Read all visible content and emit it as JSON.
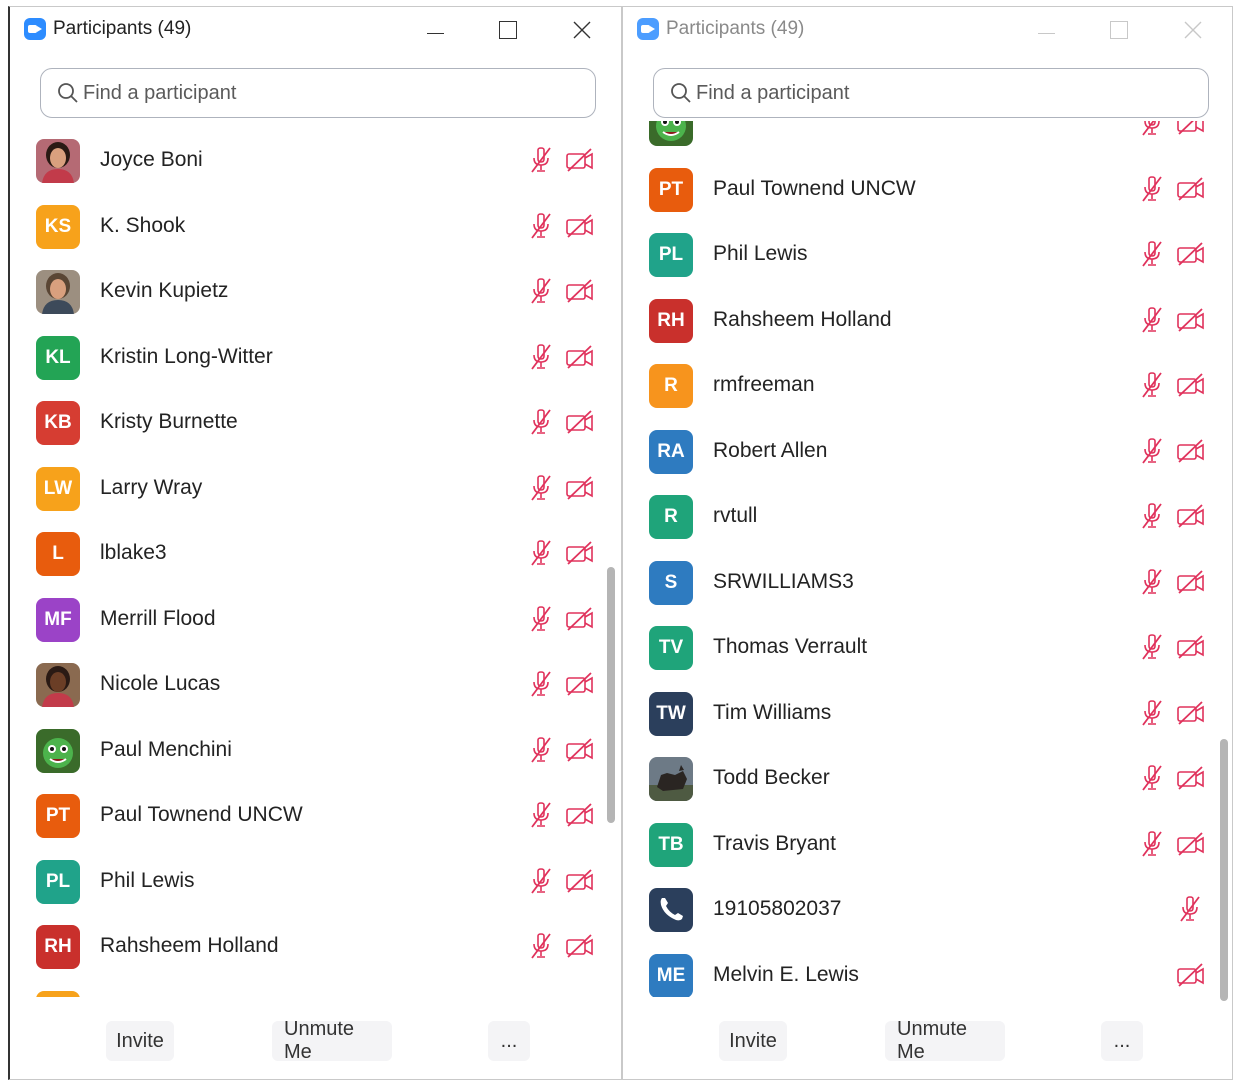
{
  "windows": [
    {
      "title": "Participants (49)",
      "active": true,
      "search_placeholder": "Find a participant",
      "participants": [
        {
          "name": "Joyce Boni",
          "initials": "",
          "avatar": "photo-woman",
          "color": "#6b3b3b",
          "mic": true,
          "cam": true
        },
        {
          "name": "K. Shook",
          "initials": "KS",
          "avatar": "initials",
          "color": "#f7a21b",
          "mic": true,
          "cam": true
        },
        {
          "name": "Kevin Kupietz",
          "initials": "",
          "avatar": "photo-man",
          "color": "#7a5a44",
          "mic": true,
          "cam": true
        },
        {
          "name": "Kristin Long-Witter",
          "initials": "KL",
          "avatar": "initials",
          "color": "#23a455",
          "mic": true,
          "cam": true
        },
        {
          "name": "Kristy Burnette",
          "initials": "KB",
          "avatar": "initials",
          "color": "#d63d32",
          "mic": true,
          "cam": true
        },
        {
          "name": "Larry Wray",
          "initials": "LW",
          "avatar": "initials",
          "color": "#f7a21b",
          "mic": true,
          "cam": true
        },
        {
          "name": "lblake3",
          "initials": "L",
          "avatar": "initials",
          "color": "#e85c0d",
          "mic": true,
          "cam": true
        },
        {
          "name": "Merrill Flood",
          "initials": "MF",
          "avatar": "initials",
          "color": "#9b43c7",
          "mic": true,
          "cam": true
        },
        {
          "name": "Nicole Lucas",
          "initials": "",
          "avatar": "photo-woman2",
          "color": "#4a2e22",
          "mic": true,
          "cam": true
        },
        {
          "name": "Paul Menchini",
          "initials": "",
          "avatar": "photo-monster",
          "color": "#2e8b2e",
          "mic": true,
          "cam": true
        },
        {
          "name": "Paul Townend UNCW",
          "initials": "PT",
          "avatar": "initials",
          "color": "#e85c0d",
          "mic": true,
          "cam": true
        },
        {
          "name": "Phil Lewis",
          "initials": "PL",
          "avatar": "initials",
          "color": "#20a38a",
          "mic": true,
          "cam": true
        },
        {
          "name": "Rahsheem Holland",
          "initials": "RH",
          "avatar": "initials",
          "color": "#c9302c",
          "mic": true,
          "cam": true
        },
        {
          "name": "",
          "initials": "",
          "avatar": "initials",
          "color": "#f7a21b",
          "mic": true,
          "cam": true
        }
      ],
      "footer": {
        "invite": "Invite",
        "unmute": "Unmute Me",
        "more": "..."
      }
    },
    {
      "title": "Participants (49)",
      "active": false,
      "search_placeholder": "Find a participant",
      "participants": [
        {
          "name": "",
          "initials": "",
          "avatar": "photo-monster",
          "color": "#2e8b2e",
          "mic": true,
          "cam": true
        },
        {
          "name": "Paul Townend UNCW",
          "initials": "PT",
          "avatar": "initials",
          "color": "#e85c0d",
          "mic": true,
          "cam": true
        },
        {
          "name": "Phil Lewis",
          "initials": "PL",
          "avatar": "initials",
          "color": "#20a38a",
          "mic": true,
          "cam": true
        },
        {
          "name": "Rahsheem Holland",
          "initials": "RH",
          "avatar": "initials",
          "color": "#c9302c",
          "mic": true,
          "cam": true
        },
        {
          "name": "rmfreeman",
          "initials": "R",
          "avatar": "initials",
          "color": "#f7941d",
          "mic": true,
          "cam": true
        },
        {
          "name": "Robert Allen",
          "initials": "RA",
          "avatar": "initials",
          "color": "#2e7bc0",
          "mic": true,
          "cam": true
        },
        {
          "name": "rvtull",
          "initials": "R",
          "avatar": "initials",
          "color": "#1fa47a",
          "mic": true,
          "cam": true
        },
        {
          "name": "SRWILLIAMS3",
          "initials": "S",
          "avatar": "initials",
          "color": "#2e7bc0",
          "mic": true,
          "cam": true
        },
        {
          "name": "Thomas Verrault",
          "initials": "TV",
          "avatar": "initials",
          "color": "#1fa47a",
          "mic": true,
          "cam": true
        },
        {
          "name": "Tim Williams",
          "initials": "TW",
          "avatar": "initials",
          "color": "#2b3f5c",
          "mic": true,
          "cam": true
        },
        {
          "name": "Todd Becker",
          "initials": "",
          "avatar": "photo-dog",
          "color": "#555555",
          "mic": true,
          "cam": true
        },
        {
          "name": "Travis Bryant",
          "initials": "TB",
          "avatar": "initials",
          "color": "#1fa47a",
          "mic": true,
          "cam": true
        },
        {
          "name": "19105802037",
          "initials": "",
          "avatar": "phone",
          "color": "#2b3f5c",
          "mic": true,
          "cam": false
        },
        {
          "name": "Melvin E. Lewis",
          "initials": "ME",
          "avatar": "initials",
          "color": "#2e7bc0",
          "mic": false,
          "cam": true
        }
      ],
      "footer": {
        "invite": "Invite",
        "unmute": "Unmute Me",
        "more": "..."
      }
    }
  ],
  "colors": {
    "muted_icon": "#e0325c",
    "accent": "#2d8cff"
  }
}
